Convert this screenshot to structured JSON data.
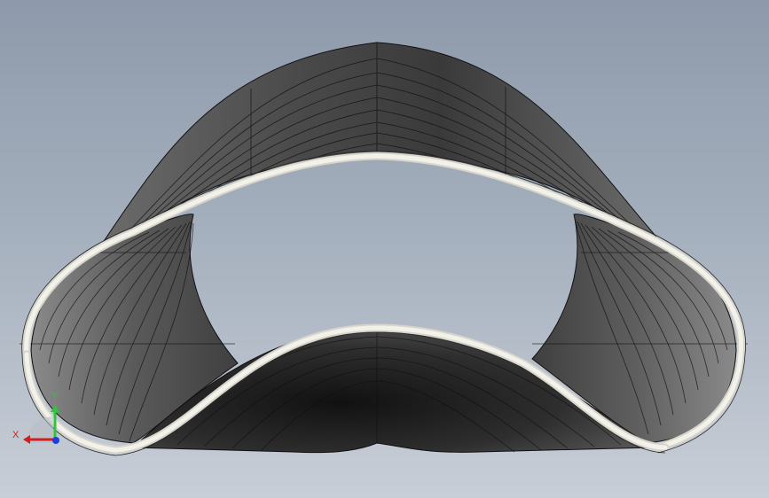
{
  "viewport": {
    "background_top": "#8e9aab",
    "background_bottom": "#c8ced7"
  },
  "model": {
    "description_name": "saddle-band",
    "face_dark": "#2b2b2b",
    "face_mid": "#5a5a5a",
    "face_light": "#7c7c7c",
    "edge_color": "#ecebe3",
    "isoline_color": "#0e0e0e"
  },
  "triad": {
    "x_label": "X",
    "y_label": "Y",
    "x_color": "#d11e1e",
    "y_color": "#2ec43b",
    "z_color": "#1a3fe0"
  }
}
